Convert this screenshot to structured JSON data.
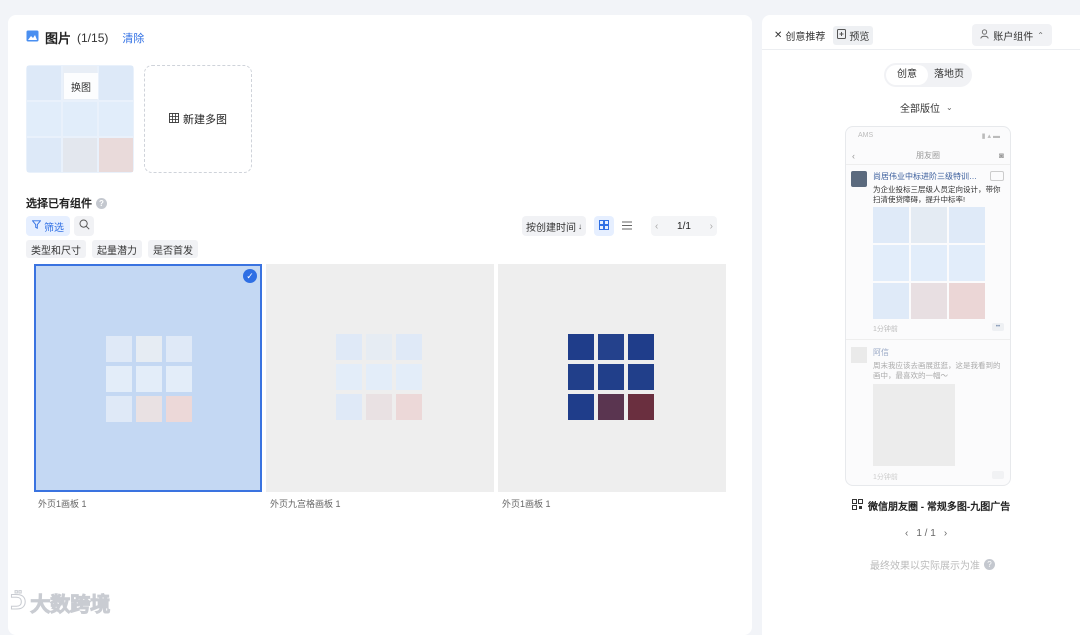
{
  "header": {
    "title": "图片",
    "count": "(1/15)",
    "clear_label": "清除",
    "account_component": "账户组件"
  },
  "thumb": {
    "swap_label": "换图"
  },
  "new_grid_label": "新建多图",
  "select_section": {
    "title": "选择已有组件"
  },
  "toolbar": {
    "filter_label": "筛选",
    "sort_label": "按创建时间",
    "pager": "1/1"
  },
  "tags": [
    "类型和尺寸",
    "起量潜力",
    "是否首发"
  ],
  "cards": [
    {
      "label": "外页1画板 1",
      "selected": true
    },
    {
      "label": "外页九宫格画板 1",
      "selected": false
    },
    {
      "label": "外页1画板 1",
      "selected": false
    }
  ],
  "right": {
    "tab_creative": "创意推荐",
    "tab_preview": "预览",
    "seg_creative": "创意",
    "seg_landing": "落地页",
    "format_label": "全部版位",
    "phone": {
      "status_left": "AMS",
      "nav_title": "朋友圈",
      "post_name": "尚居伟业中标进阶三级特训营...",
      "post_text": "为企业投标三层级人员定向设计，带你扫清使贷障碍，提升中标率!",
      "time": "1分钟前",
      "friend_name": "阿信",
      "friend_text": "周末我应该去画展逛逛，这是我看到的画中，最喜欢的一幅～",
      "friend_time": "1分钟前"
    },
    "ad_name": "微信朋友圈 - 常规多图-九图广告",
    "pager": "1 / 1",
    "note": "最终效果以实际展示为准"
  },
  "watermark": "大数跨境",
  "colors": {
    "accent": "#2f6fe4",
    "selected_bg": "#c4d8f3",
    "dark_blue": "#1f3d8a",
    "orange": "#f5a623"
  }
}
